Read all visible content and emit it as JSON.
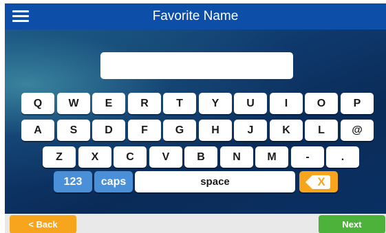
{
  "header": {
    "title": "Favorite Name",
    "menu_icon": "hamburger-menu-icon"
  },
  "name_input": {
    "value": "",
    "placeholder": ""
  },
  "keyboard": {
    "row1": [
      "Q",
      "W",
      "E",
      "R",
      "T",
      "Y",
      "U",
      "I",
      "O",
      "P"
    ],
    "row2": [
      "A",
      "S",
      "D",
      "F",
      "G",
      "H",
      "J",
      "K",
      "L",
      "@"
    ],
    "row3": [
      "Z",
      "X",
      "C",
      "V",
      "B",
      "N",
      "M",
      "-",
      "."
    ],
    "numbers_label": "123",
    "caps_label": "caps",
    "space_label": "space",
    "backspace_symbol": "X",
    "backspace_icon": "backspace-icon"
  },
  "footer": {
    "back_label": "< Back",
    "next_label": "Next"
  },
  "colors": {
    "header": "#0d4fa8",
    "background": "#0b2a55",
    "key": "#ffffff",
    "key_blue": "#4a90d9",
    "backspace": "#f7a51d",
    "back_button": "#f7a51d",
    "next_button": "#4db23a",
    "footer": "#e9e9e9"
  }
}
